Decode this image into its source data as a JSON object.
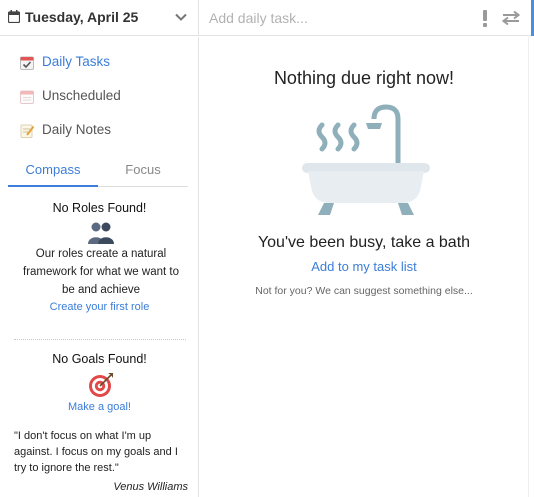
{
  "header": {
    "date_label": "Tuesday, April 25",
    "add_task_placeholder": "Add daily task...",
    "icons": [
      "calendar-icon",
      "chevron-down-icon",
      "priority-icon",
      "swap-icon"
    ]
  },
  "sidebar": {
    "items": [
      {
        "label": "Daily Tasks",
        "icon": "calendar-check-icon",
        "active": true
      },
      {
        "label": "Unscheduled",
        "icon": "calendar-blank-icon",
        "active": false
      },
      {
        "label": "Daily Notes",
        "icon": "notepad-icon",
        "active": false
      }
    ],
    "tabs": [
      {
        "label": "Compass",
        "active": true
      },
      {
        "label": "Focus",
        "active": false
      }
    ],
    "roles": {
      "title": "No Roles Found!",
      "icon": "people-icon",
      "description": "Our roles create a natural framework for what we want to be and achieve",
      "link": "Create your first role"
    },
    "goals": {
      "title": "No Goals Found!",
      "icon": "target-icon",
      "link": "Make a goal!"
    },
    "quote": {
      "text": "\"I don't focus on what I'm up against. I focus on my goals and I try to ignore the rest.\"",
      "author": "Venus Williams"
    }
  },
  "main": {
    "title": "Nothing due right now!",
    "illustration": "bathtub-icon",
    "subtitle": "You've been busy, take a bath",
    "add_link": "Add to my task list",
    "suggestion": "Not for you? We can suggest something else..."
  },
  "colors": {
    "accent": "#3b7dd8",
    "tub": "#e7edf1",
    "fixture": "#8fafbb",
    "border": "#e3e3e3"
  }
}
